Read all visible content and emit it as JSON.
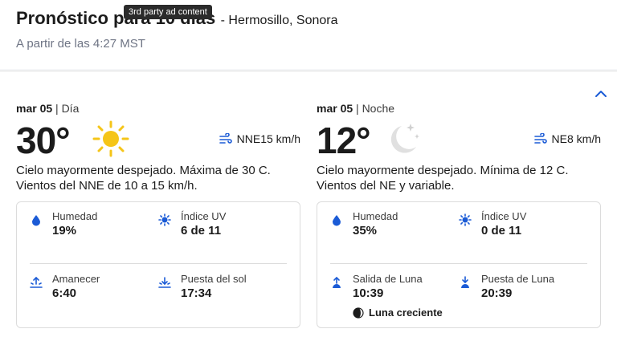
{
  "header": {
    "title": "Pronóstico para 10 días",
    "location": "- Hermosillo, Sonora",
    "subtitle": "A partir de las 4:27 MST",
    "tooltip": "3rd party ad content"
  },
  "colors": {
    "accent": "#1b5bd6",
    "text": "#1b1b1b",
    "muted": "#6f7585",
    "sun": "#f5c518",
    "moon": "#d8d8d8"
  },
  "day": {
    "date": "mar 05",
    "period": "| Día",
    "temperature": "30°",
    "icon": "sun-icon",
    "wind": "NNE15 km/h",
    "narrative": "Cielo mayormente despejado. Máxima de 30 C. Vientos del NNE de 10 a 15 km/h.",
    "details": {
      "humidity_label": "Humedad",
      "humidity_value": "19%",
      "uv_label": "Índice UV",
      "uv_value": "6 de 11",
      "sunrise_label": "Amanecer",
      "sunrise_value": "6:40",
      "sunset_label": "Puesta del sol",
      "sunset_value": "17:34"
    }
  },
  "night": {
    "date": "mar 05",
    "period": "| Noche",
    "temperature": "12°",
    "icon": "moon-stars-icon",
    "wind": "NE8 km/h",
    "narrative": "Cielo mayormente despejado. Mínima de 12 C. Vientos del NE y variable.",
    "details": {
      "humidity_label": "Humedad",
      "humidity_value": "35%",
      "uv_label": "Índice UV",
      "uv_value": "0 de 11",
      "moonrise_label": "Salida de Luna",
      "moonrise_value": "10:39",
      "moonset_label": "Puesta de Luna",
      "moonset_value": "20:39",
      "moon_phase": "Luna creciente"
    }
  }
}
